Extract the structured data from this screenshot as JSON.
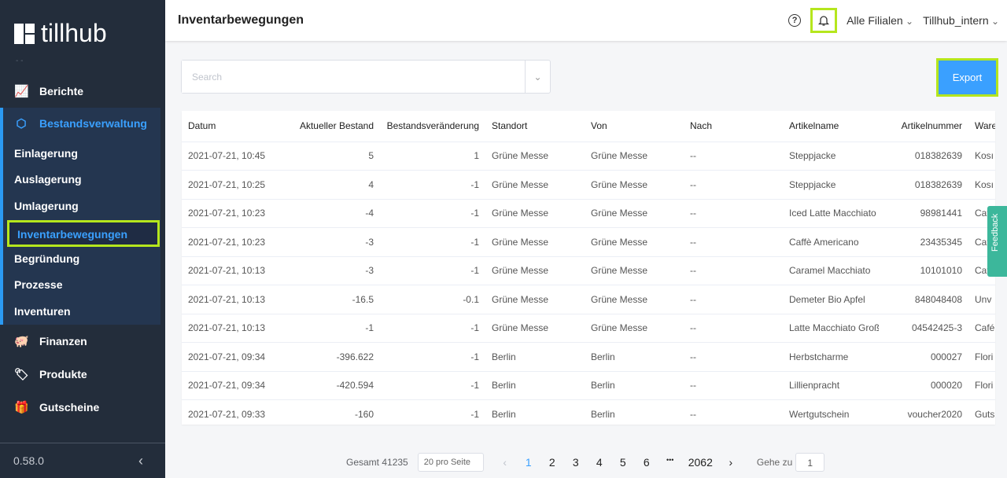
{
  "app": {
    "logo": "tillhub",
    "version": "0.58.0"
  },
  "sidebar": {
    "items": [
      {
        "label": "Berichte"
      },
      {
        "label": "Bestandsverwaltung"
      },
      {
        "label": "Finanzen"
      },
      {
        "label": "Produkte"
      },
      {
        "label": "Gutscheine"
      }
    ],
    "sub": [
      "Einlagerung",
      "Auslagerung",
      "Umlagerung",
      "Inventarbewegungen",
      "Begründung",
      "Prozesse",
      "Inventuren"
    ]
  },
  "header": {
    "title": "Inventarbewegungen",
    "branch": "Alle Filialen",
    "account": "Tillhub_intern"
  },
  "search": {
    "placeholder": "Search"
  },
  "export_label": "Export",
  "feedback": "Feedback",
  "table": {
    "headers": [
      "Datum",
      "Aktueller Bestand",
      "Bestandsveränderung",
      "Standort",
      "Von",
      "Nach",
      "Artikelname",
      "Artikelnummer",
      "Ware"
    ],
    "rows": [
      [
        "2021-07-21, 10:45",
        "5",
        "1",
        "Grüne Messe",
        "Grüne Messe",
        "--",
        "Steppjacke",
        "018382639",
        "Kosı"
      ],
      [
        "2021-07-21, 10:25",
        "4",
        "-1",
        "Grüne Messe",
        "Grüne Messe",
        "--",
        "Steppjacke",
        "018382639",
        "Kosı"
      ],
      [
        "2021-07-21, 10:23",
        "-4",
        "-1",
        "Grüne Messe",
        "Grüne Messe",
        "--",
        "Iced Latte Macchiato",
        "98981441",
        "Caf"
      ],
      [
        "2021-07-21, 10:23",
        "-3",
        "-1",
        "Grüne Messe",
        "Grüne Messe",
        "--",
        "Caffè Americano",
        "23435345",
        "Caf"
      ],
      [
        "2021-07-21, 10:13",
        "-3",
        "-1",
        "Grüne Messe",
        "Grüne Messe",
        "--",
        "Caramel Macchiato",
        "10101010",
        "Caf"
      ],
      [
        "2021-07-21, 10:13",
        "-16.5",
        "-0.1",
        "Grüne Messe",
        "Grüne Messe",
        "--",
        "Demeter Bio Apfel",
        "848048408",
        "Unv"
      ],
      [
        "2021-07-21, 10:13",
        "-1",
        "-1",
        "Grüne Messe",
        "Grüne Messe",
        "--",
        "Latte Macchiato Groß",
        "04542425-3",
        "Café"
      ],
      [
        "2021-07-21, 09:34",
        "-396.622",
        "-1",
        "Berlin",
        "Berlin",
        "--",
        "Herbstcharme",
        "000027",
        "Flori"
      ],
      [
        "2021-07-21, 09:34",
        "-420.594",
        "-1",
        "Berlin",
        "Berlin",
        "--",
        "Lillienpracht",
        "000020",
        "Flori"
      ],
      [
        "2021-07-21, 09:33",
        "-160",
        "-1",
        "Berlin",
        "Berlin",
        "--",
        "Wertgutschein",
        "voucher2020",
        "Guts"
      ]
    ]
  },
  "pagination": {
    "total": "Gesamt 41235",
    "page_size": "20 pro Seite",
    "pages": [
      "1",
      "2",
      "3",
      "4",
      "5",
      "6",
      "2062"
    ],
    "current": "1",
    "ellipsis": "•••",
    "goto_label": "Gehe zu",
    "goto_value": "1"
  }
}
